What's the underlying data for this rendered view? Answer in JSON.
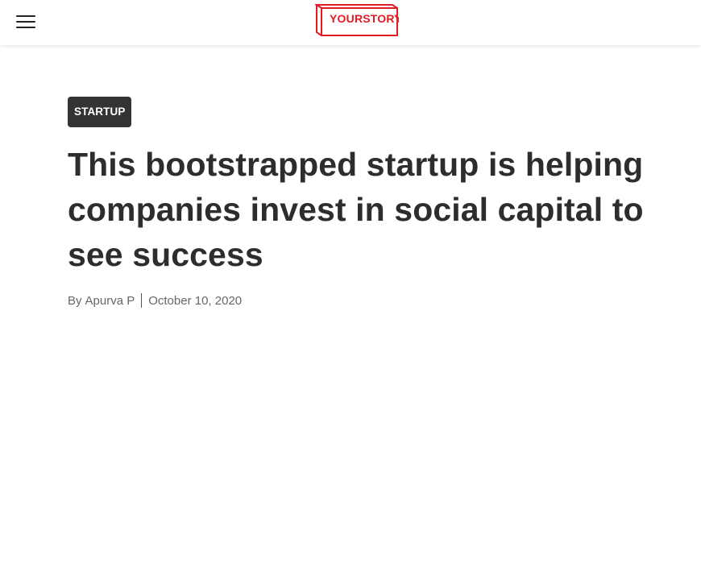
{
  "header": {
    "menu_icon": "hamburger-menu-icon",
    "logo_text": "YOURSTORY",
    "brand_color": "#e31b23"
  },
  "article": {
    "category": "STARTUP",
    "title": "This bootstrapped startup is helping companies invest in social capital to see success",
    "byline_prefix": "By",
    "author": "Apurva P",
    "date": "October 10, 2020"
  }
}
